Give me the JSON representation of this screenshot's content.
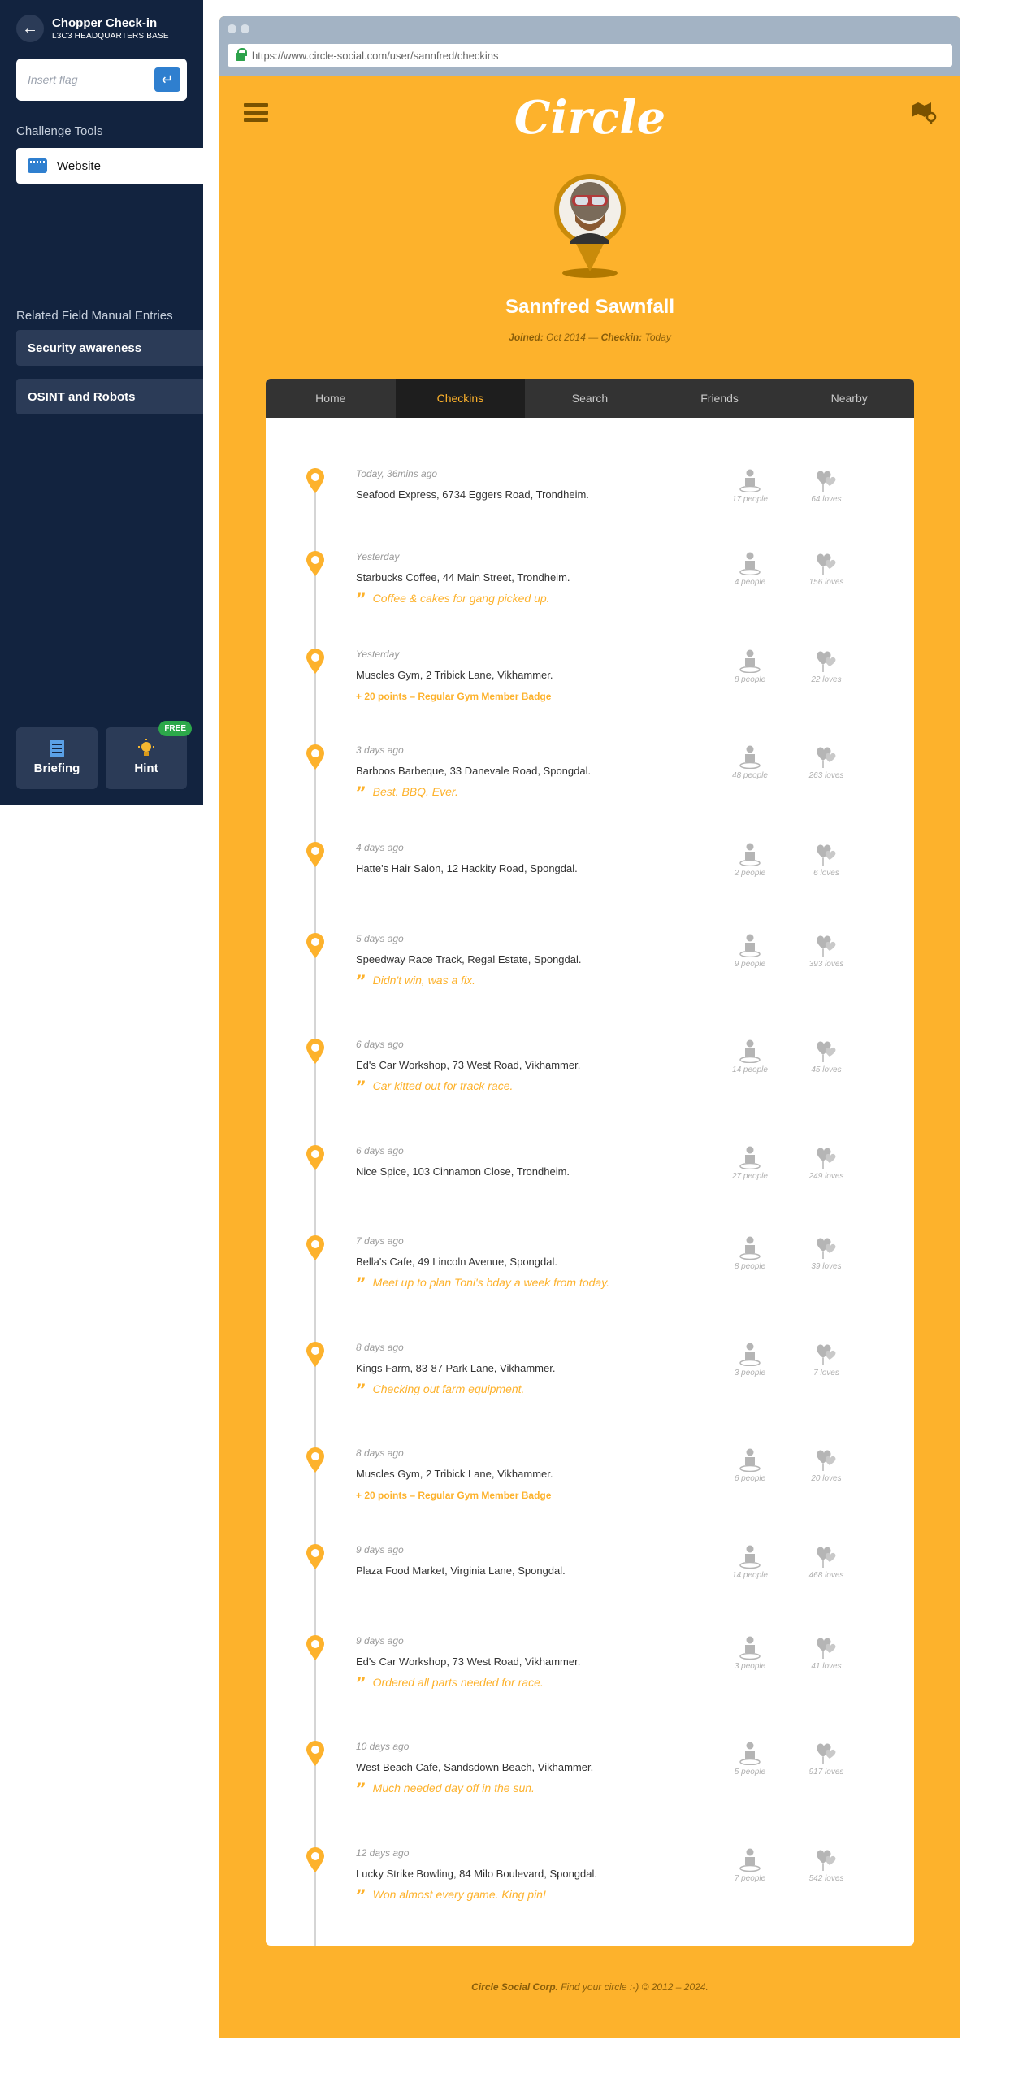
{
  "sidebar": {
    "title": "Chopper Check-in",
    "subtitle": "L3C3 HEADQUARTERS BASE",
    "flag_placeholder": "Insert flag",
    "challenge_tools_label": "Challenge Tools",
    "tools": [
      "Website"
    ],
    "manual_label": "Related Field Manual Entries",
    "manual_entries": [
      "Security awareness",
      "OSINT and Robots"
    ],
    "briefing_label": "Briefing",
    "hint_label": "Hint",
    "hint_badge": "FREE"
  },
  "browser": {
    "url": "https://www.circle-social.com/user/sannfred/checkins"
  },
  "site": {
    "logo": "Circle",
    "profile_name": "Sannfred Sawnfall",
    "joined_label": "Joined:",
    "joined_value": "Oct 2014",
    "separator": "—",
    "checkin_label": "Checkin:",
    "checkin_value": "Today",
    "tabs": [
      "Home",
      "Checkins",
      "Search",
      "Friends",
      "Nearby"
    ],
    "active_tab": "Checkins",
    "accent_color": "#fdb22c",
    "footer_company": "Circle Social Corp.",
    "footer_text": "Find your circle :-) © 2012 – 2024."
  },
  "checkins": [
    {
      "when": "Today, 36mins ago",
      "place": "Seafood Express, 6734 Eggers Road, Trondheim.",
      "note": "",
      "badge": "",
      "people": "17 people",
      "loves": "64 loves"
    },
    {
      "when": "Yesterday",
      "place": "Starbucks Coffee, 44 Main Street, Trondheim.",
      "note": "Coffee & cakes for gang picked up.",
      "badge": "",
      "people": "4 people",
      "loves": "156 loves"
    },
    {
      "when": "Yesterday",
      "place": "Muscles Gym, 2 Tribick Lane, Vikhammer.",
      "note": "",
      "badge": "+ 20 points – Regular Gym Member Badge",
      "people": "8 people",
      "loves": "22 loves"
    },
    {
      "when": "3 days ago",
      "place": "Barboos Barbeque, 33 Danevale Road, Spongdal.",
      "note": "Best. BBQ. Ever.",
      "badge": "",
      "people": "48 people",
      "loves": "263 loves"
    },
    {
      "when": "4 days ago",
      "place": "Hatte's Hair Salon, 12 Hackity Road, Spongdal.",
      "note": "",
      "badge": "",
      "people": "2 people",
      "loves": "6 loves"
    },
    {
      "when": "5 days ago",
      "place": "Speedway Race Track, Regal Estate, Spongdal.",
      "note": "Didn't win, was a fix.",
      "badge": "",
      "people": "9 people",
      "loves": "393 loves"
    },
    {
      "when": "6 days ago",
      "place": "Ed's Car Workshop, 73 West Road, Vikhammer.",
      "note": "Car kitted out for track race.",
      "badge": "",
      "people": "14 people",
      "loves": "45 loves"
    },
    {
      "when": "6 days ago",
      "place": "Nice Spice, 103 Cinnamon Close, Trondheim.",
      "note": "",
      "badge": "",
      "people": "27 people",
      "loves": "249 loves"
    },
    {
      "when": "7 days ago",
      "place": "Bella's Cafe, 49 Lincoln Avenue, Spongdal.",
      "note": "Meet up to plan Toni's bday a week from today.",
      "badge": "",
      "people": "8 people",
      "loves": "39 loves"
    },
    {
      "when": "8 days ago",
      "place": "Kings Farm, 83-87 Park Lane, Vikhammer.",
      "note": "Checking out farm equipment.",
      "badge": "",
      "people": "3 people",
      "loves": "7 loves"
    },
    {
      "when": "8 days ago",
      "place": "Muscles Gym, 2 Tribick Lane, Vikhammer.",
      "note": "",
      "badge": "+ 20 points – Regular Gym Member Badge",
      "people": "6 people",
      "loves": "20 loves"
    },
    {
      "when": "9 days ago",
      "place": "Plaza Food Market, Virginia Lane, Spongdal.",
      "note": "",
      "badge": "",
      "people": "14 people",
      "loves": "468 loves"
    },
    {
      "when": "9 days ago",
      "place": "Ed's Car Workshop, 73 West Road, Vikhammer.",
      "note": "Ordered all parts needed for race.",
      "badge": "",
      "people": "3 people",
      "loves": "41 loves"
    },
    {
      "when": "10 days ago",
      "place": "West Beach Cafe, Sandsdown Beach, Vikhammer.",
      "note": "Much needed day off in the sun.",
      "badge": "",
      "people": "5 people",
      "loves": "917 loves"
    },
    {
      "when": "12 days ago",
      "place": "Lucky Strike Bowling, 84 Milo Boulevard, Spongdal.",
      "note": "Won almost every game. King pin!",
      "badge": "",
      "people": "7 people",
      "loves": "542 loves"
    }
  ]
}
